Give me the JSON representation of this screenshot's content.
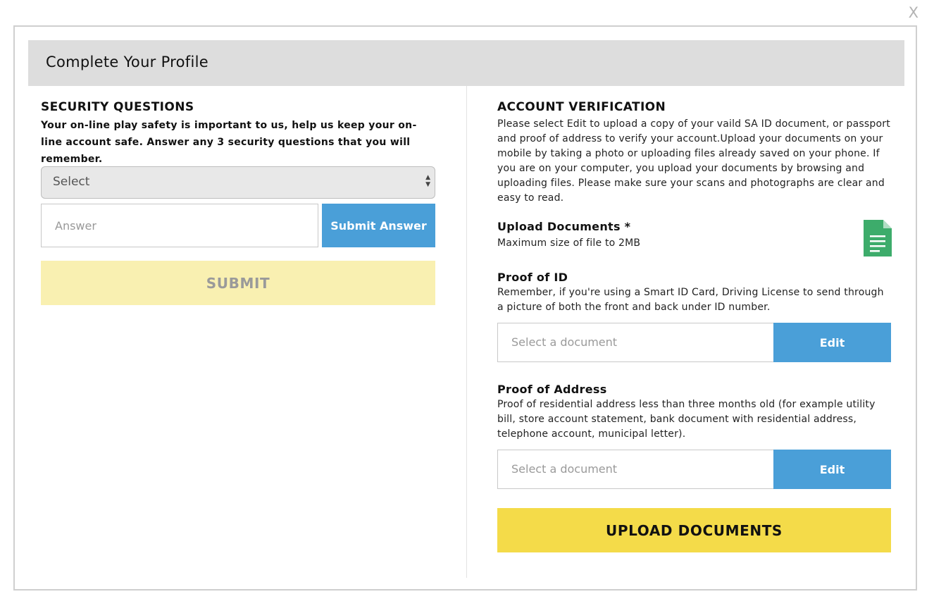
{
  "close_label": "X",
  "modal": {
    "title": "Complete Your Profile"
  },
  "security": {
    "title": "SECURITY QUESTIONS",
    "description": "Your on-line play safety is important to us, help us keep your on-line account safe. Answer any 3 security questions that you will remember.",
    "select_value": "Select",
    "answer_placeholder": "Answer",
    "submit_answer_label": "Submit Answer",
    "submit_label": "SUBMIT"
  },
  "verification": {
    "title": "ACCOUNT VERIFICATION",
    "description": "Please select Edit to upload a copy of your vaild SA ID document, or passport and proof of address to verify your account.Upload your documents on your mobile by taking a photo or uploading files already saved on your phone. If you are on your computer, you upload your documents by browsing and uploading files. Please make sure your scans and photographs are clear and easy to read.",
    "upload_title": "Upload Documents *",
    "upload_note": "Maximum size of file to 2MB",
    "proof_id_title": "Proof of ID",
    "proof_id_desc": "Remember, if you're using a Smart ID Card, Driving License to send through a picture of both the front and back under ID number.",
    "proof_address_title": "Proof of Address",
    "proof_address_desc": "Proof of residential address less than three months old (for example utility bill, store account statement, bank document with residential address, telephone account, municipal letter).",
    "doc_placeholder": "Select a document",
    "edit_label": "Edit",
    "upload_label": "UPLOAD DOCUMENTS"
  },
  "icons": {
    "document": "document-icon",
    "select_arrows": "up-down-arrows-icon"
  },
  "colors": {
    "accent_blue": "#4a9fd8",
    "upload_yellow": "#f4db49",
    "submit_yellow_disabled": "#f9f0b1",
    "doc_icon_green": "#3dac6b",
    "header_gray": "#dddddd"
  }
}
